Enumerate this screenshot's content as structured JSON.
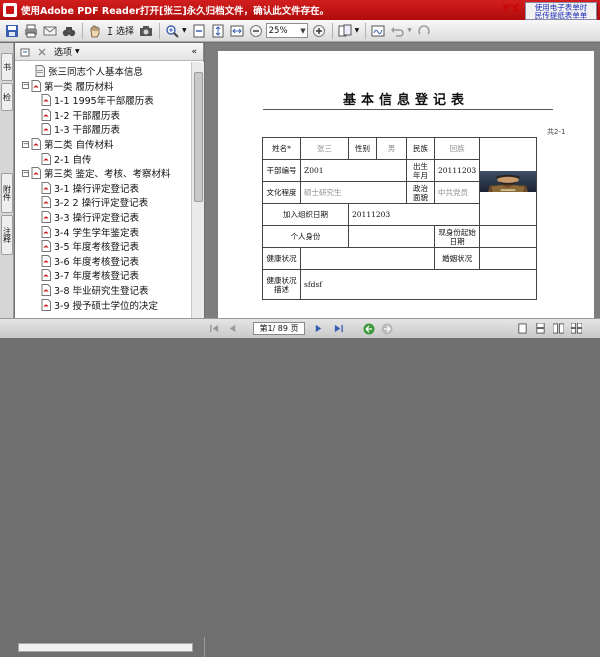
{
  "window": {
    "title": "使用Adobe PDF Reader打开[张三]永久归档文件，确认此文件存在。",
    "minimize_icon": "minimize-icon",
    "maximize_icon": "maximize-icon",
    "close_icon": "close-icon"
  },
  "toolbar": {
    "select_label": "选择",
    "zoom_value": "25%",
    "notice_line1": "使用电子表单时",
    "notice_line2": "民传提纸表单单",
    "brand_label": "Y℃"
  },
  "sidebar": {
    "tabs": [
      "书",
      "检",
      "附件",
      "注释"
    ],
    "options_label": "选项",
    "root_label": "张三同志个人基本信息",
    "items": [
      {
        "label": "第一类 履历材料",
        "level": 1
      },
      {
        "label": "1-1 1995年干部履历表",
        "level": 2
      },
      {
        "label": "1-2 干部履历表",
        "level": 2
      },
      {
        "label": "1-3 干部履历表",
        "level": 2
      },
      {
        "label": "第二类 自传材料",
        "level": 1
      },
      {
        "label": "2-1 自传",
        "level": 2
      },
      {
        "label": "第三类 鉴定、考核、考察材料",
        "level": 1
      },
      {
        "label": "3-1 操行评定登记表",
        "level": 2
      },
      {
        "label": "3-2 2 操行评定登记表",
        "level": 2
      },
      {
        "label": "3-3 操行评定登记表",
        "level": 2
      },
      {
        "label": "3-4 学生学年鉴定表",
        "level": 2
      },
      {
        "label": "3-5 年度考核登记表",
        "level": 2
      },
      {
        "label": "3-6 年度考核登记表",
        "level": 2
      },
      {
        "label": "3-7 年度考核登记表",
        "level": 2
      },
      {
        "label": "3-8 毕业研究生登记表",
        "level": 2
      },
      {
        "label": "3-9 授予硕士学位的决定",
        "level": 2
      }
    ]
  },
  "document": {
    "title": "基本信息登记表",
    "page_note": "共2-1",
    "form": {
      "name_label": "姓名*",
      "name_value": "张三",
      "gender_label": "性别",
      "gender_value": "男",
      "ethnic_label": "民族",
      "ethnic_value": "回族",
      "cadre_no_label": "干部编号",
      "cadre_no_value": "Z001",
      "birth_label": "出生年月",
      "birth_value": "20111203",
      "education_label": "文化程度",
      "education_value": "硕士研究生",
      "political_label": "政治面貌",
      "political_value": "中共党员",
      "join_org_label": "加入组织日期",
      "join_org_value": "20111203",
      "personal_identity_label": "个人身份",
      "personal_identity_value": "",
      "current_start_label": "现身份起始日期",
      "current_start_value": "",
      "health_label": "健康状况",
      "health_value": "",
      "marital_label": "婚姻状况",
      "marital_value": "",
      "health_desc_label": "健康状况描述",
      "health_desc_value": "sfdsf"
    }
  },
  "statusbar": {
    "page_display": "第1/ 89 页"
  }
}
